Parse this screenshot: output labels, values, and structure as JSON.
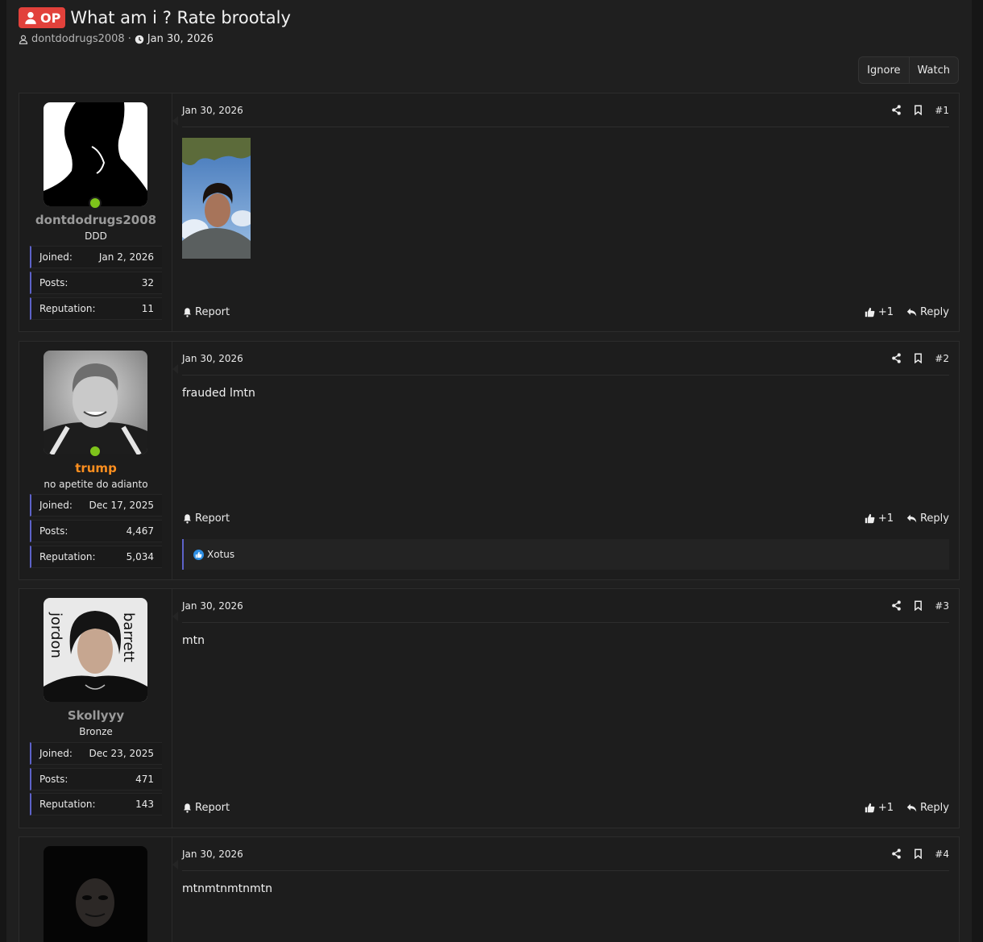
{
  "thread": {
    "op_badge": "OP",
    "title": "What am i ? Rate brootaly",
    "author": "dontdodrugs2008",
    "separator": "·",
    "date": "Jan 30, 2026"
  },
  "actions": {
    "ignore": "Ignore",
    "watch": "Watch"
  },
  "stat_labels": {
    "joined": "Joined:",
    "posts": "Posts:",
    "reputation": "Reputation:"
  },
  "footer": {
    "report": "Report",
    "like_count": "+1",
    "reply": "Reply"
  },
  "posts": [
    {
      "number": "#1",
      "date": "Jan 30, 2026",
      "user": {
        "name": "dontdodrugs2008",
        "title": "DDD",
        "joined": "Jan 2, 2026",
        "posts": "32",
        "reputation": "11",
        "online": true,
        "name_color": "#9a9a9a"
      },
      "body": "",
      "has_image": true
    },
    {
      "number": "#2",
      "date": "Jan 30, 2026",
      "user": {
        "name": "trump",
        "title": "no apetite do adianto",
        "joined": "Dec 17, 2025",
        "posts": "4,467",
        "reputation": "5,034",
        "online": true,
        "name_color": "#ff8f1f"
      },
      "body": "frauded lmtn",
      "reactions": "Xotus"
    },
    {
      "number": "#3",
      "date": "Jan 30, 2026",
      "user": {
        "name": "Skollyyy",
        "title": "Bronze",
        "joined": "Dec 23, 2025",
        "posts": "471",
        "reputation": "143",
        "online": false,
        "name_color": "#9a9a9a"
      },
      "body": "mtn"
    },
    {
      "number": "#4",
      "date": "Jan 30, 2026",
      "user": {
        "online": false
      },
      "body": "mtnmtnmtnmtn"
    }
  ],
  "avatar_texts": {
    "skolly_left": "jordon",
    "skolly_right": "barrett"
  }
}
